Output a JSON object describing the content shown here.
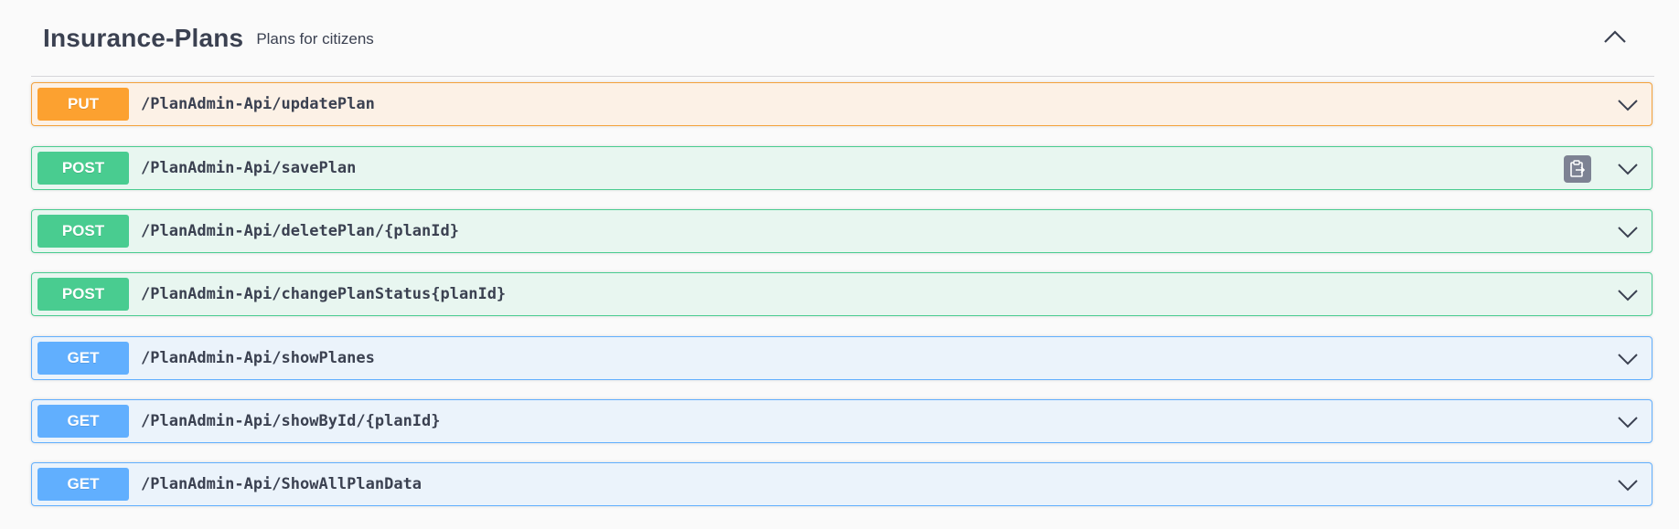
{
  "tag": {
    "title": "Insurance-Plans",
    "description": "Plans for citizens",
    "collapse_icon": "chevron-up-icon"
  },
  "operations": [
    {
      "method": "PUT",
      "path": "/PlanAdmin-Api/updatePlan"
    },
    {
      "method": "POST",
      "path": "/PlanAdmin-Api/savePlan",
      "copy_icon": "clipboard-icon"
    },
    {
      "method": "POST",
      "path": "/PlanAdmin-Api/deletePlan/{planId}"
    },
    {
      "method": "POST",
      "path": "/PlanAdmin-Api/changePlanStatus{planId}"
    },
    {
      "method": "GET",
      "path": "/PlanAdmin-Api/showPlanes"
    },
    {
      "method": "GET",
      "path": "/PlanAdmin-Api/showById/{planId}"
    },
    {
      "method": "GET",
      "path": "/PlanAdmin-Api/ShowAllPlanData"
    }
  ],
  "colors": {
    "put": "#fca130",
    "post": "#49cc90",
    "get": "#61affe",
    "text": "#3b4151"
  }
}
